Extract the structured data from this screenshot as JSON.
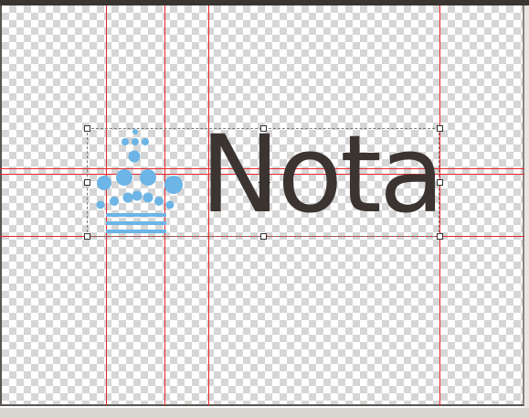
{
  "canvas": {
    "background": "transparency-checkerboard",
    "checker_color": "#d6d6d6"
  },
  "guides": {
    "color": "#e8262c",
    "vertical_count": 4,
    "horizontal_count": 3
  },
  "logo": {
    "word": "Nota",
    "word_color": "#3b3430",
    "mark": "crown-of-dots-icon",
    "mark_color": "#6cb5e6"
  },
  "selection": {
    "handles": 8,
    "transform_center": "crosshair-icon"
  }
}
